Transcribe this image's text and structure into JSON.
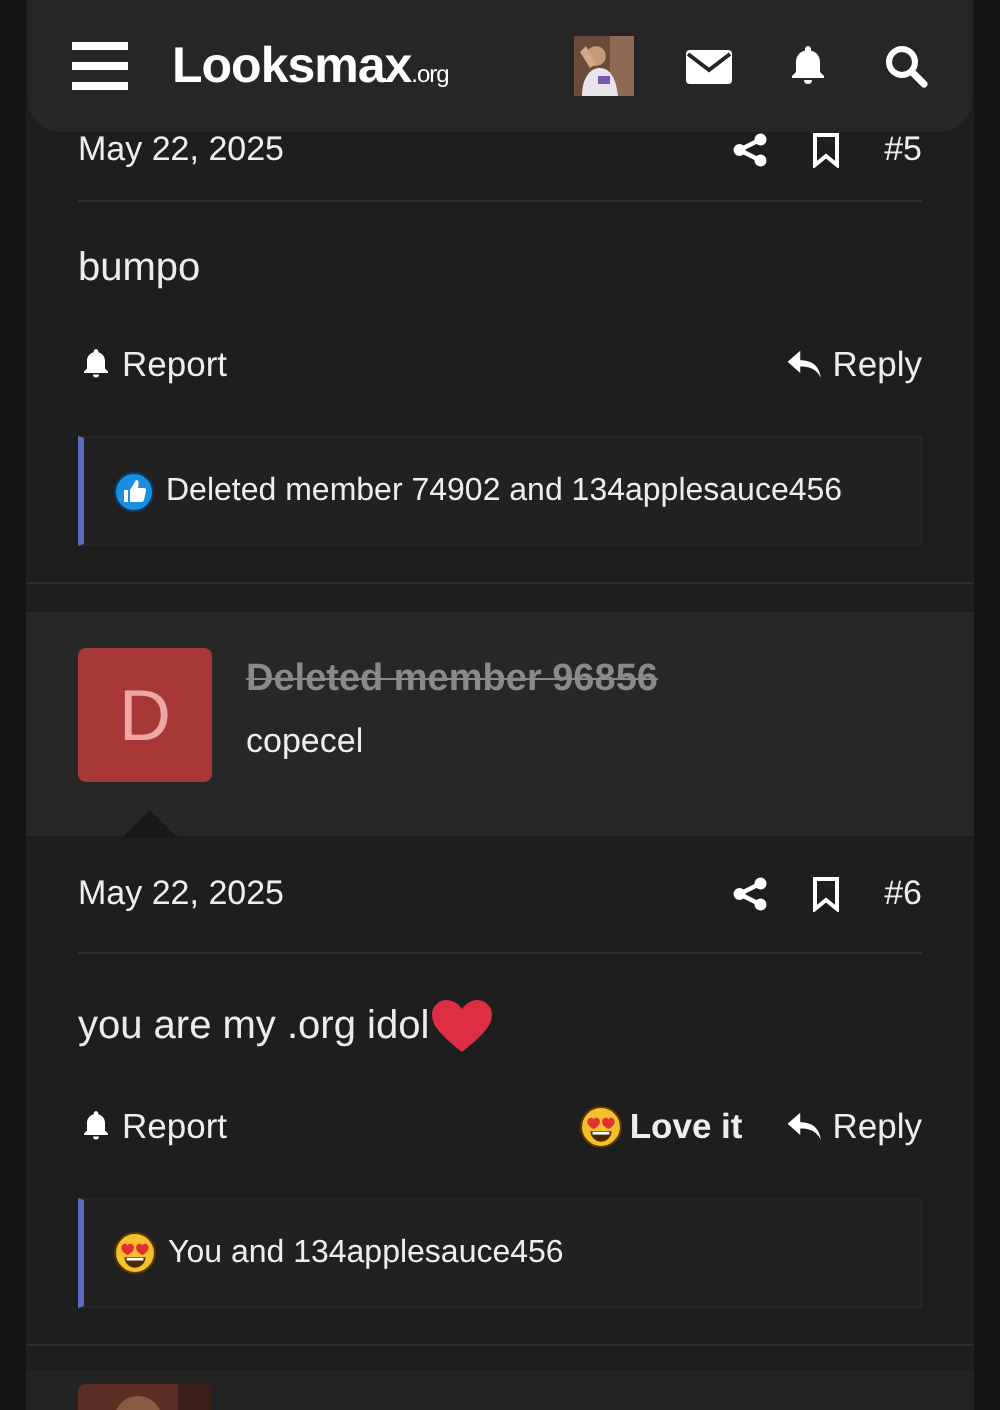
{
  "header": {
    "logo_main": "Looksmax",
    "logo_suffix": ".org"
  },
  "posts": [
    {
      "date": "May 22, 2025",
      "number": "#5",
      "message": "bumpo",
      "actions": [
        {
          "kind": "report",
          "label": "Report"
        },
        {
          "kind": "reply",
          "label": "Reply"
        }
      ],
      "reaction": {
        "kind": "like",
        "text": "Deleted member 74902 and 134applesauce456"
      }
    },
    {
      "author": {
        "initial": "D",
        "name": "Deleted member 96856",
        "deleted": true,
        "title": "copecel"
      },
      "date": "May 22, 2025",
      "number": "#6",
      "message": "you are my .org idol",
      "heart_emoji": true,
      "actions": [
        {
          "kind": "report",
          "label": "Report"
        },
        {
          "kind": "love",
          "label": "Love it",
          "selected": true
        },
        {
          "kind": "reply",
          "label": "Reply"
        }
      ],
      "reaction": {
        "kind": "love",
        "text": "You and 134applesauce456"
      }
    }
  ]
}
